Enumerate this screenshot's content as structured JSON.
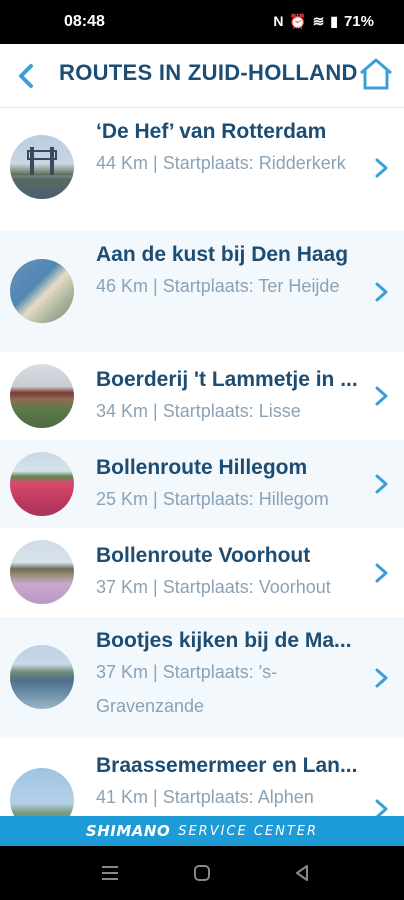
{
  "status_bar": {
    "time": "08:48",
    "icons": "N ⏰ ≋ ▮",
    "battery": "71%"
  },
  "header": {
    "title": "ROUTES IN ZUID-HOLLAND",
    "back_icon": "chevron-left-icon",
    "home_icon": "home-icon"
  },
  "routes": [
    {
      "title": "‘De Hef’ van Rotterdam",
      "meta": "44 Km | Startplaats: Ridderkerk"
    },
    {
      "title": "Aan de kust bij Den Haag",
      "meta": "46 Km | Startplaats: Ter Heijde"
    },
    {
      "title": "Boerderij 't Lammetje in ...",
      "meta": "34 Km | Startplaats: Lisse"
    },
    {
      "title": "Bollenroute Hillegom",
      "meta": "25 Km | Startplaats: Hillegom"
    },
    {
      "title": "Bollenroute Voorhout",
      "meta": "37 Km | Startplaats: Voorhout"
    },
    {
      "title": "Bootjes kijken bij de Ma...",
      "meta": "37 Km | Startplaats: 's-Gravenzande"
    },
    {
      "title": "Braassemermeer en Lan...",
      "meta": "41 Km | Startplaats: Alphen"
    }
  ],
  "footer": {
    "brand": "SHIMANO",
    "service": "SERVICE CENTER"
  },
  "colors": {
    "primary": "#1d4d73",
    "accent": "#3a9fd8",
    "banner": "#1d9bd7",
    "meta_text": "#8ba2b6"
  }
}
